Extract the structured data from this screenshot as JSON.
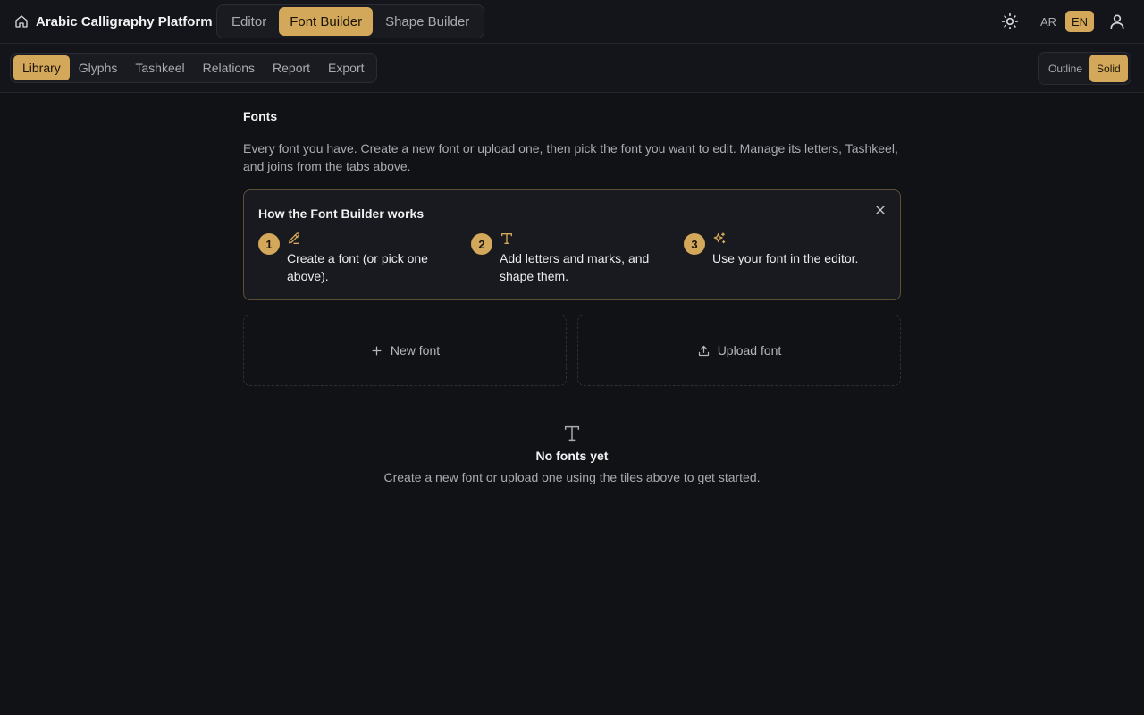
{
  "app": {
    "title": "Arabic Calligraphy Platform"
  },
  "main_tabs": [
    {
      "label": "Editor",
      "active": false
    },
    {
      "label": "Font Builder",
      "active": true
    },
    {
      "label": "Shape Builder",
      "active": false
    }
  ],
  "header_icons": {
    "home": "home-icon",
    "theme": "sun-icon",
    "account": "user-icon"
  },
  "language": {
    "options": [
      "AR",
      "EN"
    ],
    "selected": "EN"
  },
  "sub_tabs": [
    {
      "label": "Library",
      "active": true
    },
    {
      "label": "Glyphs",
      "active": false
    },
    {
      "label": "Tashkeel",
      "active": false
    },
    {
      "label": "Relations",
      "active": false
    },
    {
      "label": "Report",
      "active": false
    },
    {
      "label": "Export",
      "active": false
    }
  ],
  "style_toggle": {
    "options": [
      "Outline",
      "Solid"
    ],
    "selected": "Solid"
  },
  "page": {
    "title": "Fonts",
    "description": "Every font you have. Create a new font or upload one, then pick the font you want to edit. Manage its letters, Tashkeel, and joins from the tabs above."
  },
  "howto": {
    "title": "How the Font Builder works",
    "steps": [
      {
        "number": "1",
        "icon": "pencil-icon",
        "text": "Create a font (or pick one above)."
      },
      {
        "number": "2",
        "icon": "type-icon",
        "text": "Add letters and marks, and shape them."
      },
      {
        "number": "3",
        "icon": "sparkles-icon",
        "text": "Use your font in the editor."
      }
    ]
  },
  "actions": {
    "new_font": "New font",
    "upload_font": "Upload font"
  },
  "empty_state": {
    "icon": "type-icon",
    "title": "No fonts yet",
    "text": "Create a new font or upload one using the tiles above to get started."
  },
  "colors": {
    "background": "#111216",
    "accent": "#d4a85a",
    "muted_text": "#a9abb2",
    "border": "#2a2c33"
  }
}
